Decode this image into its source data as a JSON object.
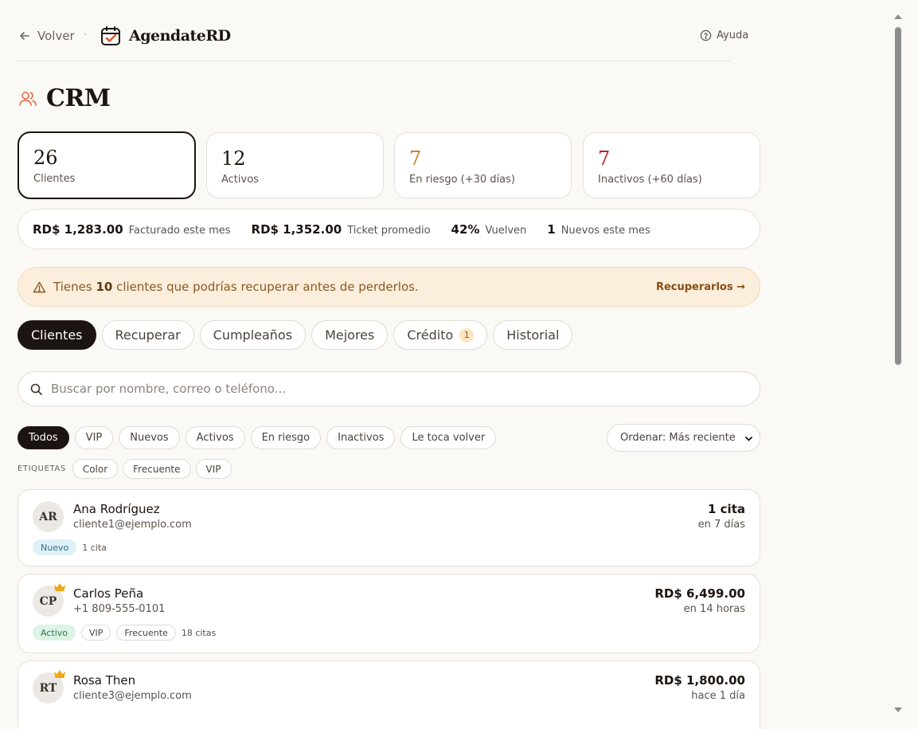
{
  "header": {
    "back_label": "Volver",
    "separator": "·",
    "brand": "AgendateRD",
    "help_label": "Ayuda"
  },
  "page": {
    "title": "CRM"
  },
  "stats": [
    {
      "value": "26",
      "label": "Clientes",
      "color": "#1c1410"
    },
    {
      "value": "12",
      "label": "Activos",
      "color": "#1c1410"
    },
    {
      "value": "7",
      "label": "En riesgo (+30 días)",
      "color": "#c7822e"
    },
    {
      "value": "7",
      "label": "Inactivos (+60 días)",
      "color": "#b5232e"
    }
  ],
  "metrics": [
    {
      "value": "RD$ 1,283.00",
      "label": "Facturado este mes"
    },
    {
      "value": "RD$ 1,352.00",
      "label": "Ticket promedio"
    },
    {
      "value": "42%",
      "label": "Vuelven"
    },
    {
      "value": "1",
      "label": "Nuevos este mes"
    }
  ],
  "alert": {
    "prefix": "Tienes",
    "count": "10",
    "suffix": "clientes que podrías recuperar antes de perderlos.",
    "cta": "Recuperarlos →"
  },
  "tabs": [
    {
      "label": "Clientes",
      "active": true
    },
    {
      "label": "Recuperar"
    },
    {
      "label": "Cumpleaños"
    },
    {
      "label": "Mejores"
    },
    {
      "label": "Crédito",
      "badge": "1"
    },
    {
      "label": "Historial"
    }
  ],
  "search": {
    "placeholder": "Buscar por nombre, correo o teléfono..."
  },
  "filters": [
    "Todos",
    "VIP",
    "Nuevos",
    "Activos",
    "En riesgo",
    "Inactivos",
    "Le toca volver"
  ],
  "sort": {
    "value": "Ordenar: Más reciente"
  },
  "tags": {
    "label": "ETIQUETAS",
    "items": [
      "Color",
      "Frecuente",
      "VIP"
    ]
  },
  "clients": [
    {
      "initials": "AR",
      "name": "Ana Rodríguez",
      "contact": "cliente1@ejemplo.com",
      "value": "1 cita",
      "when": "en 7 días",
      "status": "Nuevo",
      "tags": [],
      "count": "1 cita"
    },
    {
      "initials": "CP",
      "name": "Carlos Peña",
      "contact": "+1 809-555-0101",
      "value": "RD$ 6,499.00",
      "when": "en 14 horas",
      "status": "Activo",
      "tags": [
        "VIP",
        "Frecuente"
      ],
      "count": "18 citas"
    },
    {
      "initials": "RT",
      "name": "Rosa Then",
      "contact": "cliente3@ejemplo.com",
      "value": "RD$ 1,800.00",
      "when": "hace 1 día"
    }
  ]
}
